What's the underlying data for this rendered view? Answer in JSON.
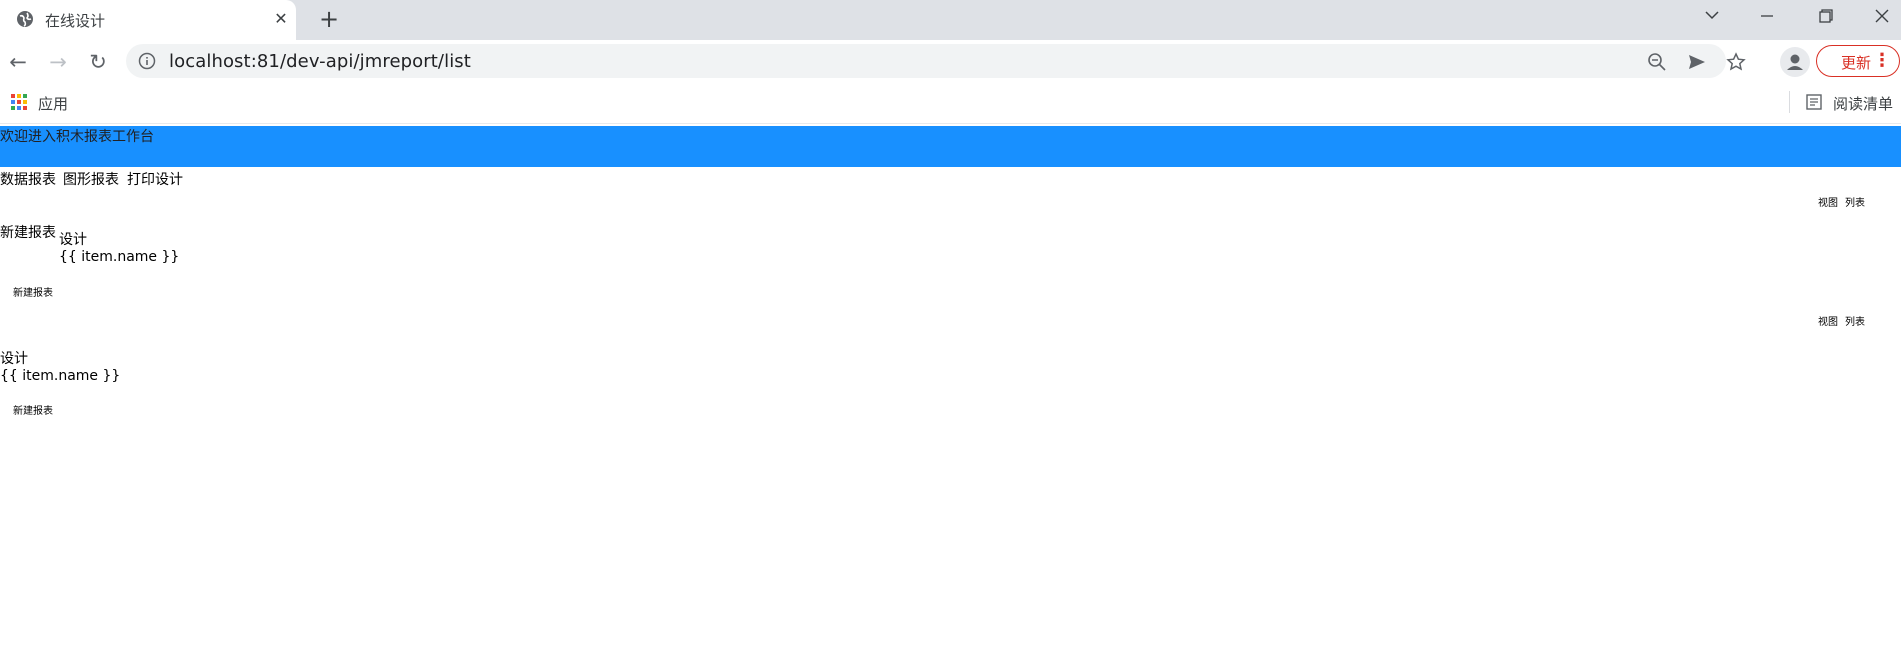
{
  "browser": {
    "tab_title": "在线设计",
    "url": "localhost:81/dev-api/jmreport/list",
    "update_label": "更新",
    "bookmarks": {
      "apps_label": "应用",
      "reading_list_label": "阅读清单"
    }
  },
  "page": {
    "banner_text": "欢迎进入积木报表工作台",
    "tabs": [
      "数据报表",
      "图形报表",
      "打印设计"
    ],
    "section1": {
      "view_label": "视图",
      "list_label": "列表",
      "new_report_card": "新建报表",
      "design_label": "设计",
      "item_template": "{{ item.name }}",
      "new_report_button": "新建报表"
    },
    "section2": {
      "view_label": "视图",
      "list_label": "列表",
      "design_label": "设计",
      "item_template": "{{ item.name }}",
      "new_report_button": "新建报表"
    }
  },
  "colors": {
    "banner": "#1890ff",
    "update_accent": "#d93025",
    "tabstrip": "#dee1e6"
  }
}
